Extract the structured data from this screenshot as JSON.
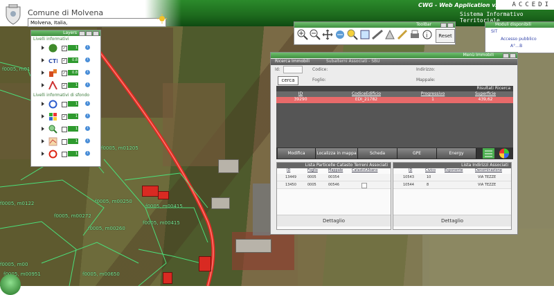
{
  "header": {
    "municipality": "Comune di Molvena",
    "search_value": "Molvena, Italia,",
    "app_title": "CWG - Web Application v. 3.2",
    "app_subtitle": "Sistema Informativo Territoriale",
    "login": "ACCEDI"
  },
  "map_labels": [
    "f0005, m01121",
    "f0005, m01205",
    "f0005, m00415",
    "f0005, m00272",
    "f0005, m00415",
    "f0005, m00260",
    "f0005, m00250",
    "f0005, m00650",
    "f0005, m00951",
    "f0005, m0122",
    "f0005, m00"
  ],
  "layers_panel": {
    "title": "Layers",
    "group1": "Livelli informativi",
    "group2": "Livelli informativi di sfondo",
    "rows": [
      {
        "check": "✓",
        "opacity": "1"
      },
      {
        "check": "✓",
        "opacity": "0.8"
      },
      {
        "check": "✓",
        "opacity": "0.8"
      },
      {
        "check": "✓",
        "opacity": "1"
      },
      {
        "check": "",
        "opacity": "1"
      },
      {
        "check": "✓",
        "opacity": "1"
      },
      {
        "check": "",
        "opacity": "1"
      },
      {
        "check": "",
        "opacity": "1"
      },
      {
        "check": "",
        "opacity": "1"
      }
    ],
    "info": "i"
  },
  "toolbar": {
    "title": "ToolBar",
    "reset": "Reset"
  },
  "moduli": {
    "title": "Moduli disponibili",
    "root": "SIT",
    "item1": "Accesso pubblico",
    "item2": "A°…B"
  },
  "immobili": {
    "title": "Menù Immobili",
    "tab1": "Ricerca Immobili",
    "tab2": "Subalterni Associati - SBU",
    "id_label": "Id:",
    "codice_label": "Codice:",
    "indirizzo_label": "Indirizzo:",
    "foglio_label": "Foglio:",
    "mappale_label": "Mappale:",
    "cerca": "cerca",
    "risultati_title": "Risultati Ricerca",
    "columns": [
      "ID",
      "CodiceEdificio",
      "Progressivo",
      "Superficie"
    ],
    "row": [
      "39290",
      "EDI_21782",
      "1",
      "439,62"
    ],
    "actions": [
      "Modifica",
      "Localizza in mappa",
      "Scheda",
      "GPE",
      "Energy"
    ],
    "particelle": {
      "title": "Lista Particelle Catasto Terreni Associati",
      "columns": [
        "ID",
        "Foglio",
        "Mappale",
        "CatastoUrbano"
      ],
      "rows": [
        [
          "13449",
          "0005",
          "00354",
          ""
        ],
        [
          "13450",
          "0005",
          "00546",
          ""
        ]
      ],
      "dettaglio": "Dettaglio"
    },
    "indirizzi": {
      "title": "Lista Indirizzi Associati",
      "columns": [
        "ID",
        "Civico",
        "Esponente",
        "Denominazione"
      ],
      "rows": [
        [
          "10543",
          "10",
          "",
          "VIA TEZZE"
        ],
        [
          "10544",
          "8",
          "",
          "VIA TEZZE"
        ]
      ],
      "dettaglio": "Dettaglio"
    }
  }
}
